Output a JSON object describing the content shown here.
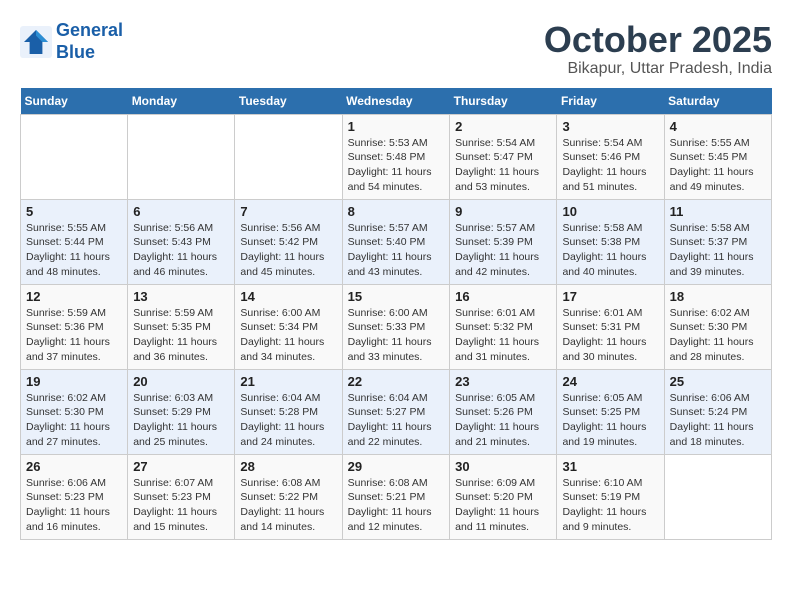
{
  "header": {
    "logo_line1": "General",
    "logo_line2": "Blue",
    "month": "October 2025",
    "location": "Bikapur, Uttar Pradesh, India"
  },
  "weekdays": [
    "Sunday",
    "Monday",
    "Tuesday",
    "Wednesday",
    "Thursday",
    "Friday",
    "Saturday"
  ],
  "weeks": [
    [
      {
        "day": "",
        "info": ""
      },
      {
        "day": "",
        "info": ""
      },
      {
        "day": "",
        "info": ""
      },
      {
        "day": "1",
        "info": "Sunrise: 5:53 AM\nSunset: 5:48 PM\nDaylight: 11 hours\nand 54 minutes."
      },
      {
        "day": "2",
        "info": "Sunrise: 5:54 AM\nSunset: 5:47 PM\nDaylight: 11 hours\nand 53 minutes."
      },
      {
        "day": "3",
        "info": "Sunrise: 5:54 AM\nSunset: 5:46 PM\nDaylight: 11 hours\nand 51 minutes."
      },
      {
        "day": "4",
        "info": "Sunrise: 5:55 AM\nSunset: 5:45 PM\nDaylight: 11 hours\nand 49 minutes."
      }
    ],
    [
      {
        "day": "5",
        "info": "Sunrise: 5:55 AM\nSunset: 5:44 PM\nDaylight: 11 hours\nand 48 minutes."
      },
      {
        "day": "6",
        "info": "Sunrise: 5:56 AM\nSunset: 5:43 PM\nDaylight: 11 hours\nand 46 minutes."
      },
      {
        "day": "7",
        "info": "Sunrise: 5:56 AM\nSunset: 5:42 PM\nDaylight: 11 hours\nand 45 minutes."
      },
      {
        "day": "8",
        "info": "Sunrise: 5:57 AM\nSunset: 5:40 PM\nDaylight: 11 hours\nand 43 minutes."
      },
      {
        "day": "9",
        "info": "Sunrise: 5:57 AM\nSunset: 5:39 PM\nDaylight: 11 hours\nand 42 minutes."
      },
      {
        "day": "10",
        "info": "Sunrise: 5:58 AM\nSunset: 5:38 PM\nDaylight: 11 hours\nand 40 minutes."
      },
      {
        "day": "11",
        "info": "Sunrise: 5:58 AM\nSunset: 5:37 PM\nDaylight: 11 hours\nand 39 minutes."
      }
    ],
    [
      {
        "day": "12",
        "info": "Sunrise: 5:59 AM\nSunset: 5:36 PM\nDaylight: 11 hours\nand 37 minutes."
      },
      {
        "day": "13",
        "info": "Sunrise: 5:59 AM\nSunset: 5:35 PM\nDaylight: 11 hours\nand 36 minutes."
      },
      {
        "day": "14",
        "info": "Sunrise: 6:00 AM\nSunset: 5:34 PM\nDaylight: 11 hours\nand 34 minutes."
      },
      {
        "day": "15",
        "info": "Sunrise: 6:00 AM\nSunset: 5:33 PM\nDaylight: 11 hours\nand 33 minutes."
      },
      {
        "day": "16",
        "info": "Sunrise: 6:01 AM\nSunset: 5:32 PM\nDaylight: 11 hours\nand 31 minutes."
      },
      {
        "day": "17",
        "info": "Sunrise: 6:01 AM\nSunset: 5:31 PM\nDaylight: 11 hours\nand 30 minutes."
      },
      {
        "day": "18",
        "info": "Sunrise: 6:02 AM\nSunset: 5:30 PM\nDaylight: 11 hours\nand 28 minutes."
      }
    ],
    [
      {
        "day": "19",
        "info": "Sunrise: 6:02 AM\nSunset: 5:30 PM\nDaylight: 11 hours\nand 27 minutes."
      },
      {
        "day": "20",
        "info": "Sunrise: 6:03 AM\nSunset: 5:29 PM\nDaylight: 11 hours\nand 25 minutes."
      },
      {
        "day": "21",
        "info": "Sunrise: 6:04 AM\nSunset: 5:28 PM\nDaylight: 11 hours\nand 24 minutes."
      },
      {
        "day": "22",
        "info": "Sunrise: 6:04 AM\nSunset: 5:27 PM\nDaylight: 11 hours\nand 22 minutes."
      },
      {
        "day": "23",
        "info": "Sunrise: 6:05 AM\nSunset: 5:26 PM\nDaylight: 11 hours\nand 21 minutes."
      },
      {
        "day": "24",
        "info": "Sunrise: 6:05 AM\nSunset: 5:25 PM\nDaylight: 11 hours\nand 19 minutes."
      },
      {
        "day": "25",
        "info": "Sunrise: 6:06 AM\nSunset: 5:24 PM\nDaylight: 11 hours\nand 18 minutes."
      }
    ],
    [
      {
        "day": "26",
        "info": "Sunrise: 6:06 AM\nSunset: 5:23 PM\nDaylight: 11 hours\nand 16 minutes."
      },
      {
        "day": "27",
        "info": "Sunrise: 6:07 AM\nSunset: 5:23 PM\nDaylight: 11 hours\nand 15 minutes."
      },
      {
        "day": "28",
        "info": "Sunrise: 6:08 AM\nSunset: 5:22 PM\nDaylight: 11 hours\nand 14 minutes."
      },
      {
        "day": "29",
        "info": "Sunrise: 6:08 AM\nSunset: 5:21 PM\nDaylight: 11 hours\nand 12 minutes."
      },
      {
        "day": "30",
        "info": "Sunrise: 6:09 AM\nSunset: 5:20 PM\nDaylight: 11 hours\nand 11 minutes."
      },
      {
        "day": "31",
        "info": "Sunrise: 6:10 AM\nSunset: 5:19 PM\nDaylight: 11 hours\nand 9 minutes."
      },
      {
        "day": "",
        "info": ""
      }
    ]
  ]
}
